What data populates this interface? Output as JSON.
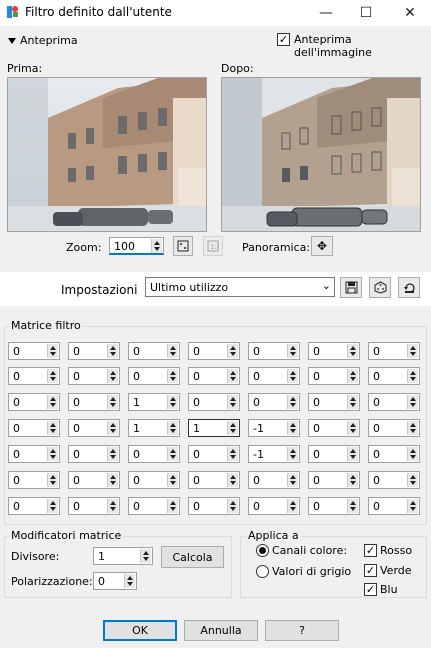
{
  "window": {
    "title": "Filtro definito dall'utente"
  },
  "preview": {
    "toggle_label": "Anteprima",
    "image_preview_label": "Anteprima dell'immagine",
    "image_preview_checked": true,
    "before_label": "Prima:",
    "after_label": "Dopo:",
    "zoom_label": "Zoom:",
    "zoom_value": "100",
    "pan_label": "Panoramica:"
  },
  "settings": {
    "label": "Impostazioni",
    "preset": "Ultimo utilizzo"
  },
  "matrix": {
    "label": "Matrice filtro",
    "rows": [
      [
        "0",
        "0",
        "0",
        "0",
        "0",
        "0",
        "0"
      ],
      [
        "0",
        "0",
        "0",
        "0",
        "0",
        "0",
        "0"
      ],
      [
        "0",
        "0",
        "1",
        "0",
        "0",
        "0",
        "0"
      ],
      [
        "0",
        "0",
        "1",
        "1",
        "-1",
        "0",
        "0"
      ],
      [
        "0",
        "0",
        "0",
        "0",
        "-1",
        "0",
        "0"
      ],
      [
        "0",
        "0",
        "0",
        "0",
        "0",
        "0",
        "0"
      ],
      [
        "0",
        "0",
        "0",
        "0",
        "0",
        "0",
        "0"
      ]
    ]
  },
  "modifiers": {
    "label": "Modificatori matrice",
    "divisor_label": "Divisore:",
    "divisor_value": "1",
    "bias_label": "Polarizzazione:",
    "bias_value": "0",
    "calc_label": "Calcola"
  },
  "apply": {
    "label": "Applica a",
    "color_channels_label": "Canali colore:",
    "color_channels_selected": true,
    "grey_values_label": "Valori di grigio",
    "red_label": "Rosso",
    "green_label": "Verde",
    "blue_label": "Blu",
    "red_checked": true,
    "green_checked": true,
    "blue_checked": true
  },
  "buttons": {
    "ok": "OK",
    "cancel": "Annulla",
    "help": "?"
  },
  "colors": {
    "accent": "#0078d7",
    "window_bg": "#f0f0f0",
    "border": "#adadad"
  }
}
